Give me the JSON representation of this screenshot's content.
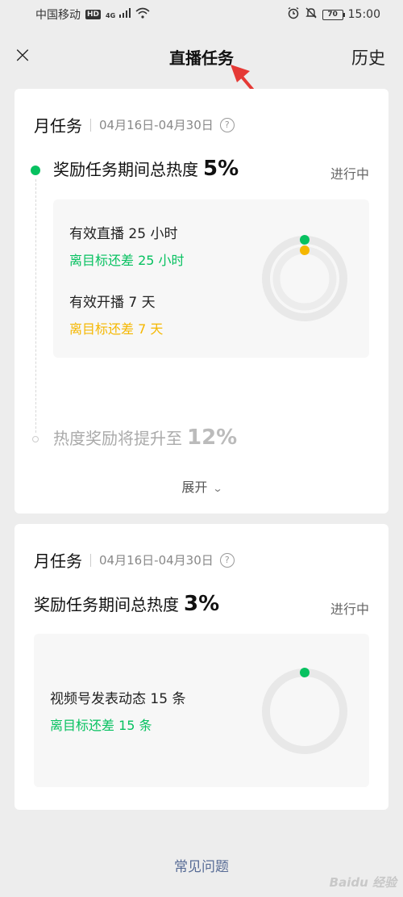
{
  "status_bar": {
    "carrier": "中国移动",
    "hd": "HD",
    "network": "4G",
    "battery": "70",
    "time": "15:00",
    "icons": [
      "signal-icon",
      "wifi-icon",
      "alarm-icon",
      "mute-icon",
      "battery-icon"
    ]
  },
  "nav": {
    "close_icon": "×",
    "title": "直播任务",
    "history_label": "历史"
  },
  "cards": [
    {
      "title": "月任务",
      "date_range": "04月16日-04月30日",
      "help": "?",
      "task_text": "奖励任务期间总热度",
      "task_pct": "5%",
      "status": "进行中",
      "requirements": [
        {
          "label": "有效直播 25 小时",
          "gap": "离目标还差 25 小时",
          "color": "#07c160"
        },
        {
          "label": "有效开播 7 天",
          "gap": "离目标还差 7 天",
          "color": "#f5b700"
        }
      ],
      "next_text": "热度奖励将提升至",
      "next_pct": "12%",
      "expand_label": "展开",
      "expand_icon": "chevron-down-icon"
    },
    {
      "title": "月任务",
      "date_range": "04月16日-04月30日",
      "help": "?",
      "task_text": "奖励任务期间总热度",
      "task_pct": "3%",
      "status": "进行中",
      "requirements": [
        {
          "label": "视频号发表动态 15 条",
          "gap": "离目标还差 15 条",
          "color": "#07c160"
        }
      ]
    }
  ],
  "footer": {
    "faq_label": "常见问题",
    "watermark": "Baidu 经验"
  },
  "colors": {
    "accent_green": "#07c160",
    "accent_yellow": "#f5b700",
    "link_blue": "#576b95",
    "annotation_red": "#e53935"
  }
}
